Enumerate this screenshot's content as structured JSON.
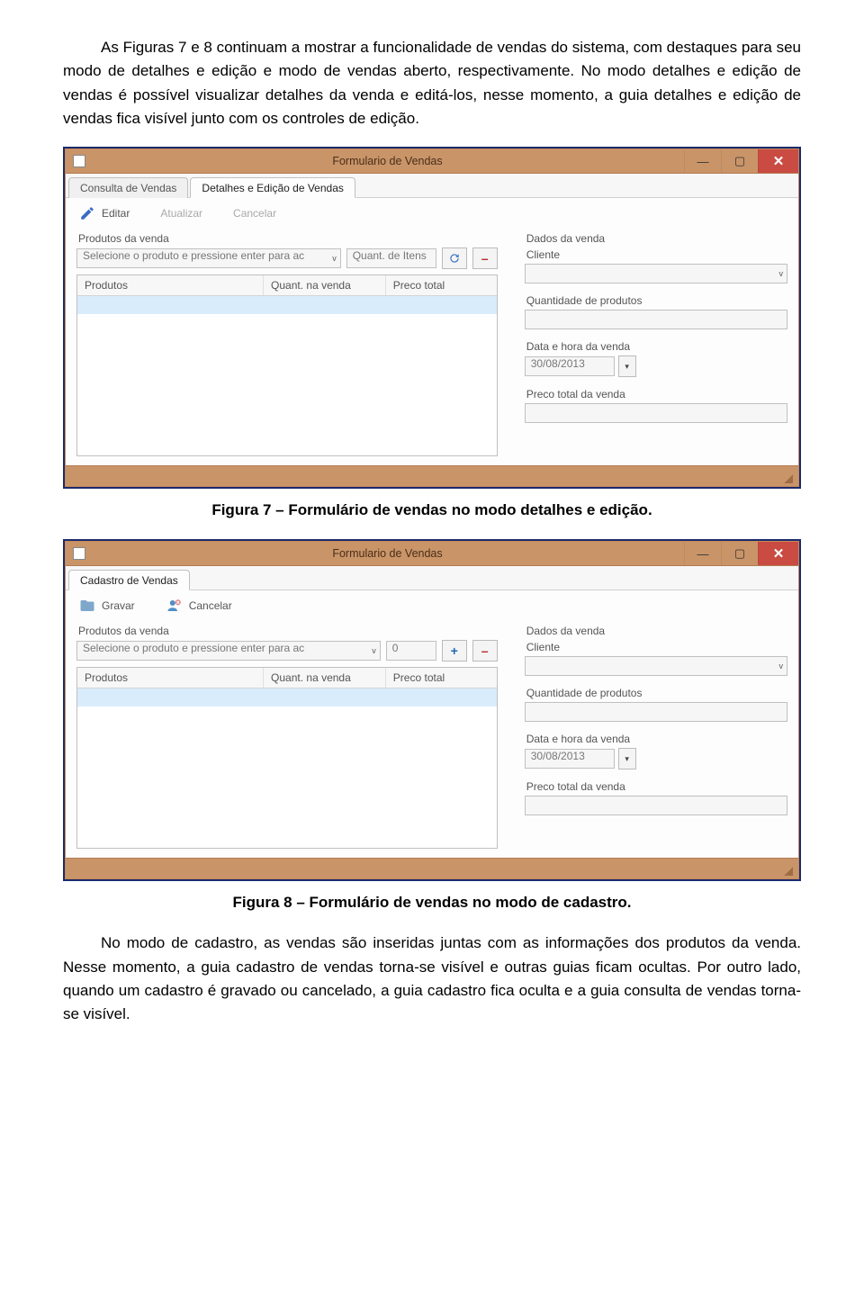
{
  "paragraphs": {
    "p1": "As Figuras 7 e 8 continuam a mostrar a funcionalidade de vendas do sistema, com destaques para seu modo de detalhes e edição e modo de vendas aberto, respectivamente. No modo detalhes e edição de vendas é possível visualizar detalhes da venda e editá-los, nesse momento, a guia detalhes e edição de vendas fica visível junto com os controles de edição.",
    "p2": "No modo de cadastro, as vendas são inseridas juntas com as informações dos produtos da venda. Nesse momento, a guia cadastro de vendas torna-se visível e outras guias ficam ocultas. Por outro lado, quando um cadastro é gravado ou cancelado, a guia cadastro fica oculta e a guia consulta de vendas torna-se visível."
  },
  "captions": {
    "fig7": "Figura 7 – Formulário de vendas no modo detalhes e edição.",
    "fig8": "Figura 8 – Formulário de vendas no modo de cadastro."
  },
  "common": {
    "window_title": "Formulario de Vendas",
    "section_products": "Produtos da venda",
    "product_placeholder": "Selecione o produto e pressione enter para ac",
    "section_sale_data": "Dados da venda",
    "lbl_client": "Cliente",
    "lbl_qty_products": "Quantidade de produtos",
    "lbl_datetime": "Data e hora da venda",
    "date_value": "30/08/2013",
    "lbl_total": "Preco total da venda",
    "grid_col_products": "Produtos",
    "grid_col_qty": "Quant. na venda",
    "grid_col_price": "Preco total"
  },
  "fig7": {
    "tabs": [
      "Consulta de Vendas",
      "Detalhes e Edição de Vendas"
    ],
    "active_tab_index": 1,
    "toolbar": {
      "edit": "Editar",
      "refresh": "Atualizar",
      "cancel": "Cancelar"
    },
    "qty_placeholder": "Quant. de Itens"
  },
  "fig8": {
    "tabs": [
      "Cadastro de Vendas"
    ],
    "active_tab_index": 0,
    "toolbar": {
      "save": "Gravar",
      "cancel": "Cancelar"
    },
    "qty_value": "0"
  }
}
